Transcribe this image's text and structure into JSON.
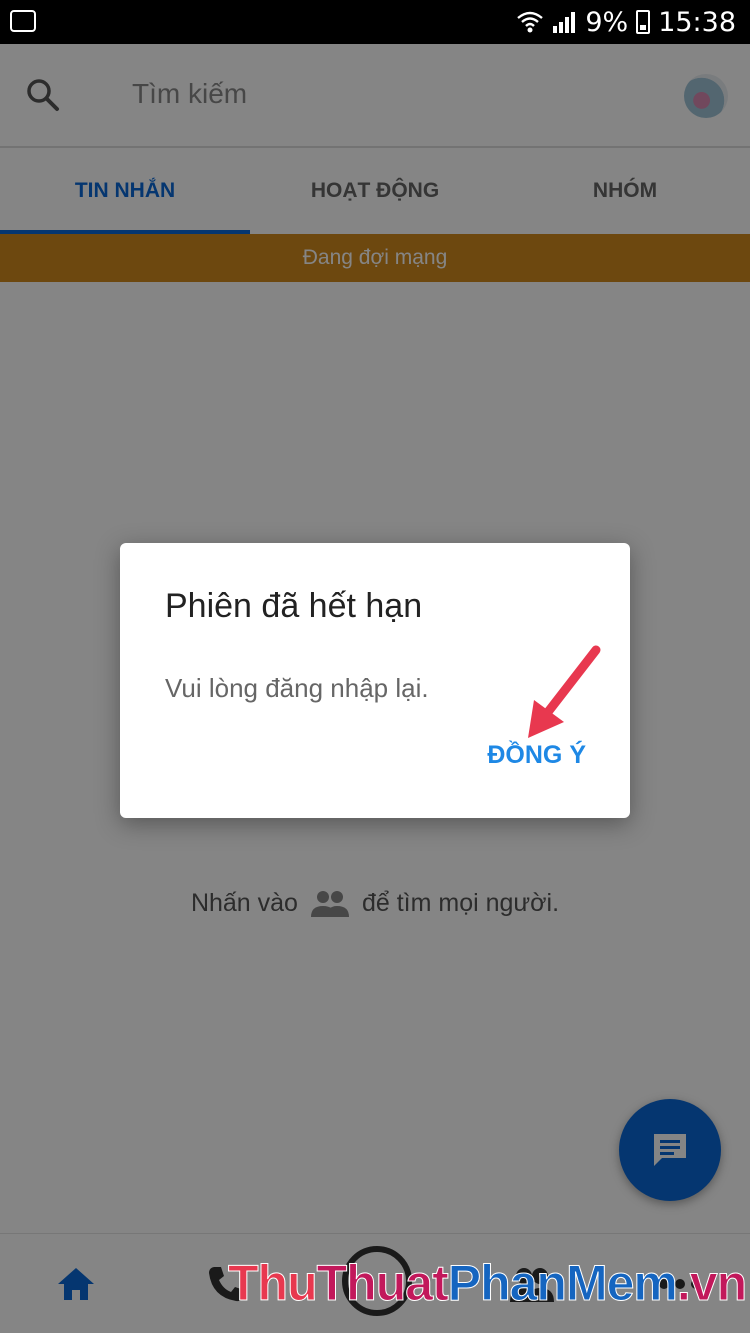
{
  "status_bar": {
    "battery": "9%",
    "time": "15:38"
  },
  "header": {
    "search_placeholder": "Tìm kiếm"
  },
  "tabs": [
    {
      "label": "TIN NHẮN",
      "active": true
    },
    {
      "label": "HOẠT ĐỘNG",
      "active": false
    },
    {
      "label": "NHÓM",
      "active": false
    }
  ],
  "network_banner": "Đang đợi mạng",
  "empty_hint": {
    "before": "Nhấn vào",
    "after": "để tìm mọi người."
  },
  "dialog": {
    "title": "Phiên đã hết hạn",
    "message": "Vui lòng đăng nhập lại.",
    "confirm_label": "ĐỒNG Ý"
  },
  "watermark": {
    "part1": "Thu",
    "part2": "Thuat",
    "part3": "PhanMem",
    "part4": ".vn"
  },
  "colors": {
    "accent": "#0a68d6",
    "banner": "#d28b1e",
    "dialog_button": "#1e88e5",
    "arrow": "#e8384f"
  },
  "icons": [
    "activity-icon",
    "wifi-icon",
    "signal-icon",
    "battery-icon",
    "search-icon",
    "people-icon",
    "chat-icon",
    "home-icon",
    "phone-icon",
    "camera-icon",
    "contacts-icon",
    "more-icon"
  ]
}
